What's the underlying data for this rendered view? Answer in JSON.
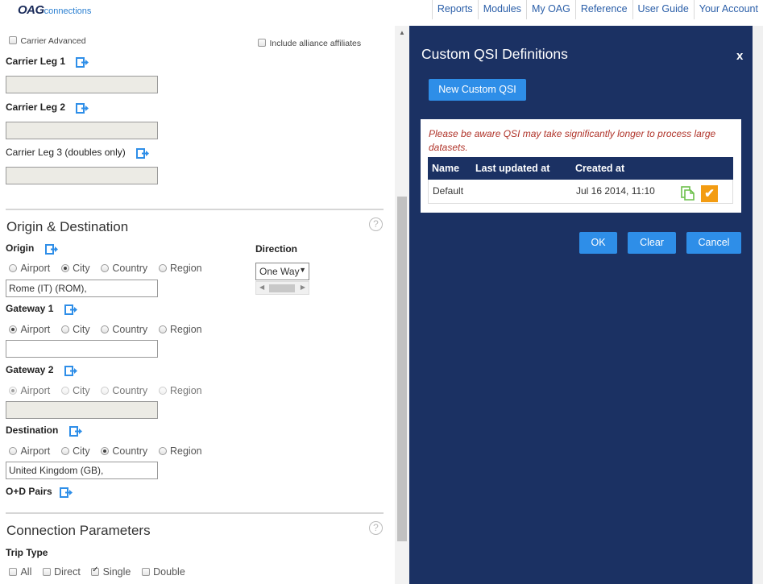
{
  "header": {
    "logo_oag": "OAG",
    "logo_connections": "connections",
    "nav": [
      "Reports",
      "Modules",
      "My OAG",
      "Reference",
      "User Guide",
      "Your Account"
    ]
  },
  "carrier": {
    "carrier_advanced": "Carrier Advanced",
    "include_alliance": "Include alliance affiliates",
    "leg1": "Carrier Leg 1",
    "leg2": "Carrier Leg 2",
    "leg3": "Carrier Leg 3 (doubles only)"
  },
  "od": {
    "section_title": "Origin & Destination",
    "help": "?",
    "origin_label": "Origin",
    "direction_label": "Direction",
    "direction_value": "One Way",
    "origin_value": "Rome (IT) (ROM),",
    "gateway1_label": "Gateway 1",
    "gateway2_label": "Gateway 2",
    "destination_label": "Destination",
    "destination_value": "United Kingdom (GB),",
    "od_pairs_label": "O+D Pairs",
    "options": {
      "airport": "Airport",
      "city": "City",
      "country": "Country",
      "region": "Region"
    }
  },
  "connection": {
    "section_title": "Connection Parameters",
    "help": "?",
    "trip_type_label": "Trip Type",
    "trip_options": {
      "all": "All",
      "direct": "Direct",
      "single": "Single",
      "double": "Double"
    }
  },
  "modal": {
    "title": "Custom QSI Definitions",
    "close": "x",
    "new_button": "New Custom QSI",
    "warning": "Please be aware QSI may take significantly longer to process large datasets.",
    "columns": [
      "Name",
      "Last updated at",
      "Created at"
    ],
    "rows": [
      {
        "name": "Default",
        "updated": "",
        "created": "Jul 16 2014, 11:10"
      }
    ],
    "ok": "OK",
    "clear": "Clear",
    "cancel": "Cancel",
    "colors": {
      "background": "#1b3163",
      "button": "#2e8ee8",
      "warning": "#b0342a",
      "check": "#f39c12"
    }
  }
}
